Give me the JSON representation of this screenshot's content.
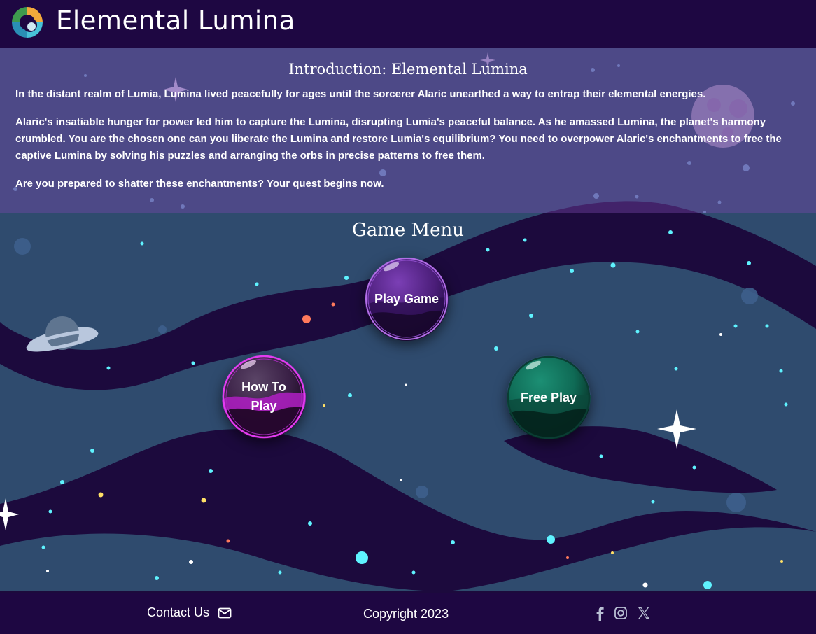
{
  "header": {
    "title": "Elemental Lumina",
    "logo_icon": "swirl-logo-icon"
  },
  "intro": {
    "title": "Introduction: Elemental Lumina",
    "paragraphs": [
      "In the distant realm of Lumia, Lumina lived peacefully for ages until the sorcerer Alaric unearthed a way to entrap their elemental energies.",
      "Alaric's insatiable hunger for power led him to capture the Lumina, disrupting Lumia's peaceful balance. As he amassed Lumina, the planet's harmony crumbled. You are the chosen one can you liberate the Lumina and restore Lumia's equilibrium? You need to overpower Alaric's enchantments to free the captive Lumina by solving his puzzles and arranging the orbs in precise patterns to free them.",
      "Are you prepared to shatter these enchantments? Your quest begins now."
    ]
  },
  "menu": {
    "title": "Game Menu",
    "play_game": "Play Game",
    "how_to_play": "How To Play",
    "free_play": "Free Play"
  },
  "footer": {
    "contact": "Contact Us",
    "copyright": "Copyright 2023",
    "icons": [
      "envelope-icon",
      "facebook-icon",
      "instagram-icon",
      "x-twitter-icon"
    ]
  },
  "colors": {
    "header_bg": "#1e0742",
    "space_bg": "#1c0a3d",
    "nebula": "#2f4b6e",
    "orb_play": "#6b2fa3",
    "orb_how": "#8e1f9e",
    "orb_free": "#0f7a62"
  }
}
